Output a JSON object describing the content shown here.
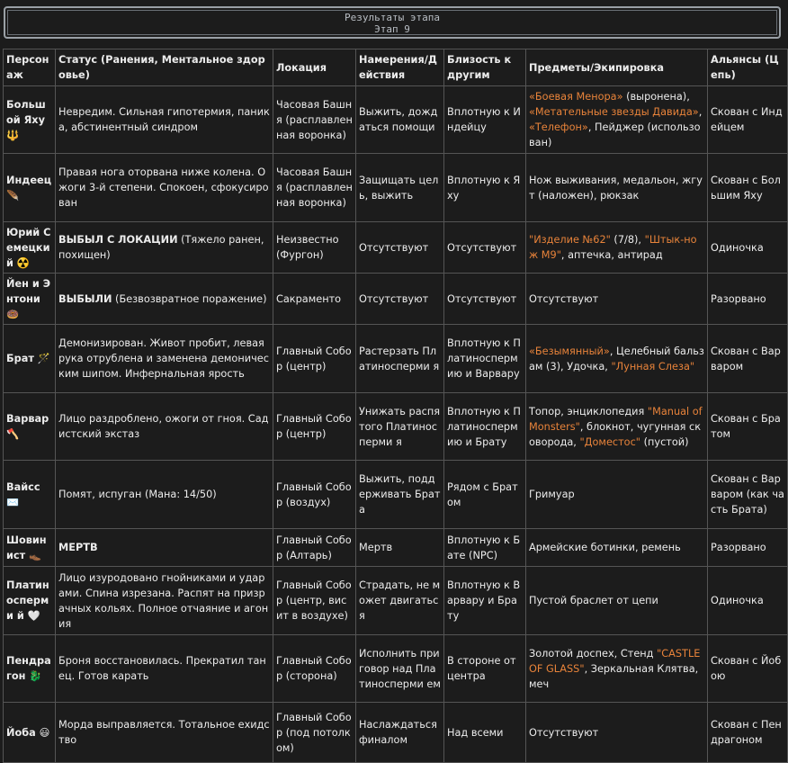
{
  "banner": {
    "title": "Результаты этапа",
    "subtitle": "Этап 9"
  },
  "columns": [
    "Персонаж",
    "Статус (Ранения, Ментальное здоровье)",
    "Локация",
    "Намерения/Действия",
    "Близость к другим",
    "Предметы/Экипировка",
    "Альянсы (Цепь)"
  ],
  "rows": [
    {
      "name": "Большой Яху 🔱",
      "status": [
        {
          "t": "Невредим. Сильная гипотермия, паника, абстинентный синдром"
        }
      ],
      "location": "Часовая Башня (расплавленная воронка)",
      "intent": "Выжить, дождаться помощи",
      "proximity": "Вплотную к Индейцу",
      "items": [
        {
          "t": "«Боевая Менора»",
          "hl": true
        },
        {
          "t": " (выронена), "
        },
        {
          "t": "«Метательные звезды Давида»",
          "hl": true
        },
        {
          "t": ", "
        },
        {
          "t": "«Телефон»",
          "hl": true
        },
        {
          "t": ", Пейджер (использован)"
        }
      ],
      "alliance": "Скован с Индейцем"
    },
    {
      "name": "Индеец 🪶",
      "status": [
        {
          "t": "Правая нога оторвана ниже колена. Ожоги 3-й степени. Спокоен, сфокусирован"
        }
      ],
      "location": "Часовая Башня (расплавленная воронка)",
      "intent": "Защищать цель, выжить",
      "proximity": "Вплотную к Яху",
      "items": [
        {
          "t": "Нож выживания, медальон, жгут (наложен), рюкзак"
        }
      ],
      "alliance": "Скован с Большим Яху"
    },
    {
      "name": "Юрий Семецкий ☢️",
      "status": [
        {
          "t": "ВЫБЫЛ С ЛОКАЦИИ",
          "b": true
        },
        {
          "t": " (Тяжело ранен, похищен)"
        }
      ],
      "location": "Неизвестно (Фургон)",
      "intent": "Отсутствуют",
      "proximity": "Отсутствуют",
      "items": [
        {
          "t": "\"Изделие №62\"",
          "hl": true
        },
        {
          "t": " (7/8), "
        },
        {
          "t": "\"Штык-нож М9\"",
          "hl": true
        },
        {
          "t": ", аптечка, антирад"
        }
      ],
      "alliance": "Одиночка"
    },
    {
      "name": "Йен и Энтони 🍩",
      "status": [
        {
          "t": "ВЫБЫЛИ",
          "b": true
        },
        {
          "t": " (Безвозвратное поражение)"
        }
      ],
      "location": "Сакраменто",
      "intent": "Отсутствуют",
      "proximity": "Отсутствуют",
      "items": [
        {
          "t": "Отсутствуют"
        }
      ],
      "alliance": "Разорвано"
    },
    {
      "name": "Брат 🪄",
      "status": [
        {
          "t": "Демонизирован. Живот пробит, левая рука отрублена и заменена демоническим шипом. Инфернальная ярость"
        }
      ],
      "location": "Главный Собор (центр)",
      "intent": "Растерзать Платиносперми я",
      "proximity": "Вплотную к Платиносперм ию и Варвару",
      "items": [
        {
          "t": "«Безымянный»",
          "hl": true
        },
        {
          "t": ", Целебный бальзам (3), Удочка, "
        },
        {
          "t": "\"Лунная Слеза\"",
          "hl": true
        }
      ],
      "alliance": "Скован с Варваром"
    },
    {
      "name": "Варвар 🪓",
      "status": [
        {
          "t": "Лицо раздроблено, ожоги от гноя. Садистский экстаз"
        }
      ],
      "location": "Главный Собор (центр)",
      "intent": "Унижать распятого Платиносперми я",
      "proximity": "Вплотную к Платиносперм ию и Брату",
      "items": [
        {
          "t": "Топор, энциклопедия "
        },
        {
          "t": "\"Manual of Monsters\"",
          "hl": true
        },
        {
          "t": ", блокнот, чугунная сковорода, "
        },
        {
          "t": "\"Доместос\"",
          "hl": true
        },
        {
          "t": " (пустой)"
        }
      ],
      "alliance": "Скован с Братом"
    },
    {
      "name": "Вайсс ✉️",
      "status": [
        {
          "t": "Помят, испуган (Мана: 14/50)"
        }
      ],
      "location": "Главный Собор (воздух)",
      "intent": "Выжить, поддерживать Брата",
      "proximity": "Рядом с Братом",
      "items": [
        {
          "t": "Гримуар"
        }
      ],
      "alliance": "Скован с Варваром (как часть Брата)"
    },
    {
      "name": "Шовинист 👞",
      "status": [
        {
          "t": "МЕРТВ",
          "b": true
        }
      ],
      "location": "Главный Собор (Алтарь)",
      "intent": "Мертв",
      "proximity": "Вплотную к Бате (NPC)",
      "items": [
        {
          "t": "Армейские ботинки, ремень"
        }
      ],
      "alliance": "Разорвано"
    },
    {
      "name": "Платиносперми й 🤍",
      "status": [
        {
          "t": "Лицо изуродовано гнойниками и ударами. Спина изрезана. Распят на призрачных кольях. Полное отчаяние и агония"
        }
      ],
      "location": "Главный Собор (центр, висит в воздухе)",
      "intent": "Страдать, не может двигаться",
      "proximity": "Вплотную к Варвару и Брату",
      "items": [
        {
          "t": "Пустой браслет от цепи"
        }
      ],
      "alliance": "Одиночка"
    },
    {
      "name": "Пендрагон 🐉",
      "status": [
        {
          "t": "Броня восстановилась. Прекратил танец. Готов карать"
        }
      ],
      "location": "Главный Собор (сторона)",
      "intent": "Исполнить приговор над Платиносперми ем",
      "proximity": "В стороне от центра",
      "items": [
        {
          "t": "Золотой доспех, Стенд "
        },
        {
          "t": "\"CASTLE OF GLASS\"",
          "hl": true
        },
        {
          "t": ", Зеркальная Клятва, меч"
        }
      ],
      "alliance": "Скован с Йобою"
    },
    {
      "name": "Йоба 😃",
      "status": [
        {
          "t": "Морда выправляется. Тотальное ехидство"
        }
      ],
      "location": "Главный Собор (под потолком)",
      "intent": "Наслаждаться финалом",
      "proximity": "Над всеми",
      "items": [
        {
          "t": "Отсутствуют"
        }
      ],
      "alliance": "Скован с Пендрагоном"
    }
  ]
}
